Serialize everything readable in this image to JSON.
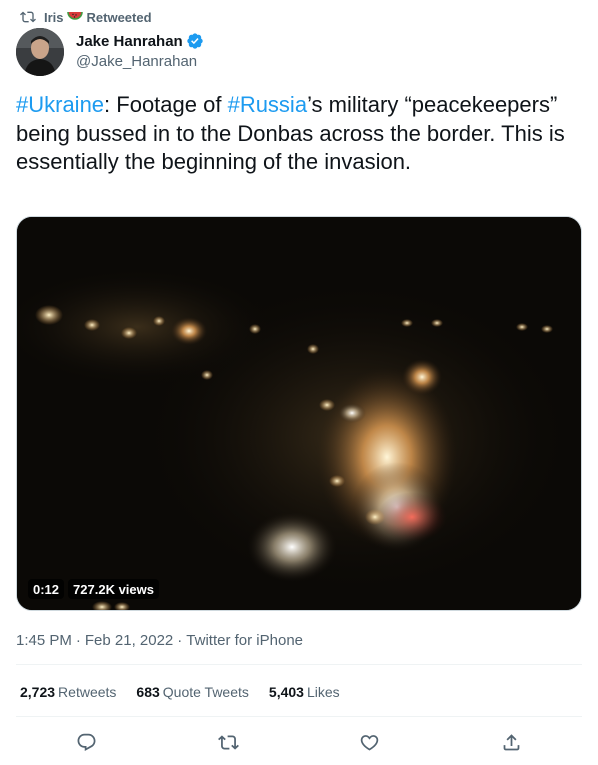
{
  "retweet_header": {
    "retweeter": "Iris",
    "label": "Retweeted",
    "icon": "retweet-icon",
    "emoji": "watermelon"
  },
  "author": {
    "name": "Jake Hanrahan",
    "handle": "@Jake_Hanrahan",
    "verified": true
  },
  "tweet": {
    "segments": [
      {
        "text": "#Ukraine",
        "hashtag": true
      },
      {
        "text": ": Footage of ",
        "hashtag": false
      },
      {
        "text": "#Russia",
        "hashtag": true
      },
      {
        "text": "’s military “peacekeepers” being bussed in to the Donbas across the border. This is essentially the beginning of the invasion.",
        "hashtag": false
      }
    ]
  },
  "video": {
    "duration": "0:12",
    "views": "727.2K views"
  },
  "meta": {
    "time": "1:45 PM",
    "separator": "·",
    "date": "Feb 21, 2022",
    "source": "Twitter for iPhone"
  },
  "stats": {
    "retweets_count": "2,723",
    "retweets_label": "Retweets",
    "quotes_count": "683",
    "quotes_label": "Quote Tweets",
    "likes_count": "5,403",
    "likes_label": "Likes"
  },
  "actions": [
    "reply-icon",
    "retweet-icon",
    "like-icon",
    "share-icon"
  ],
  "colors": {
    "link": "#1d9bf0",
    "text": "#0f1419",
    "secondary": "#536471",
    "divider": "#eff3f4"
  }
}
